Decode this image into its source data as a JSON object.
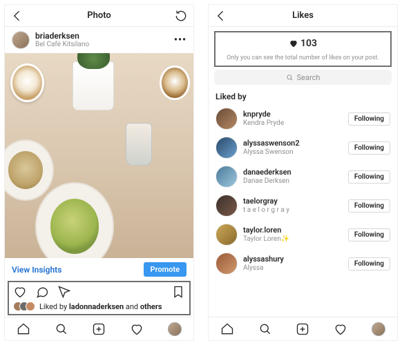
{
  "left": {
    "header": {
      "title": "Photo"
    },
    "user": {
      "username": "briaderksen",
      "location": "Bel Café Kitsilano",
      "more": "•••"
    },
    "insights": {
      "view": "View Insights",
      "promote": "Promote"
    },
    "liked": {
      "prefix": "Liked by ",
      "name": "ladonnaderksen",
      "suffix": " and ",
      "others": "others"
    }
  },
  "right": {
    "header": {
      "title": "Likes"
    },
    "summary": {
      "count": "103",
      "note": "Only you can see the total number of likes on your post."
    },
    "search": {
      "placeholder": "Search"
    },
    "section": "Liked by",
    "follow_label": "Following",
    "likers": [
      {
        "u": "knpryde",
        "n": "Kendra Pryde"
      },
      {
        "u": "alyssaswenson2",
        "n": "Alyssa Swenson"
      },
      {
        "u": "danaederksen",
        "n": "Danae Derksen"
      },
      {
        "u": "taelorgray",
        "n": "t a e l o r  g r a y"
      },
      {
        "u": "taylor.loren",
        "n": "Taylor Loren✨"
      },
      {
        "u": "alyssashury",
        "n": "Alyssa"
      }
    ]
  }
}
